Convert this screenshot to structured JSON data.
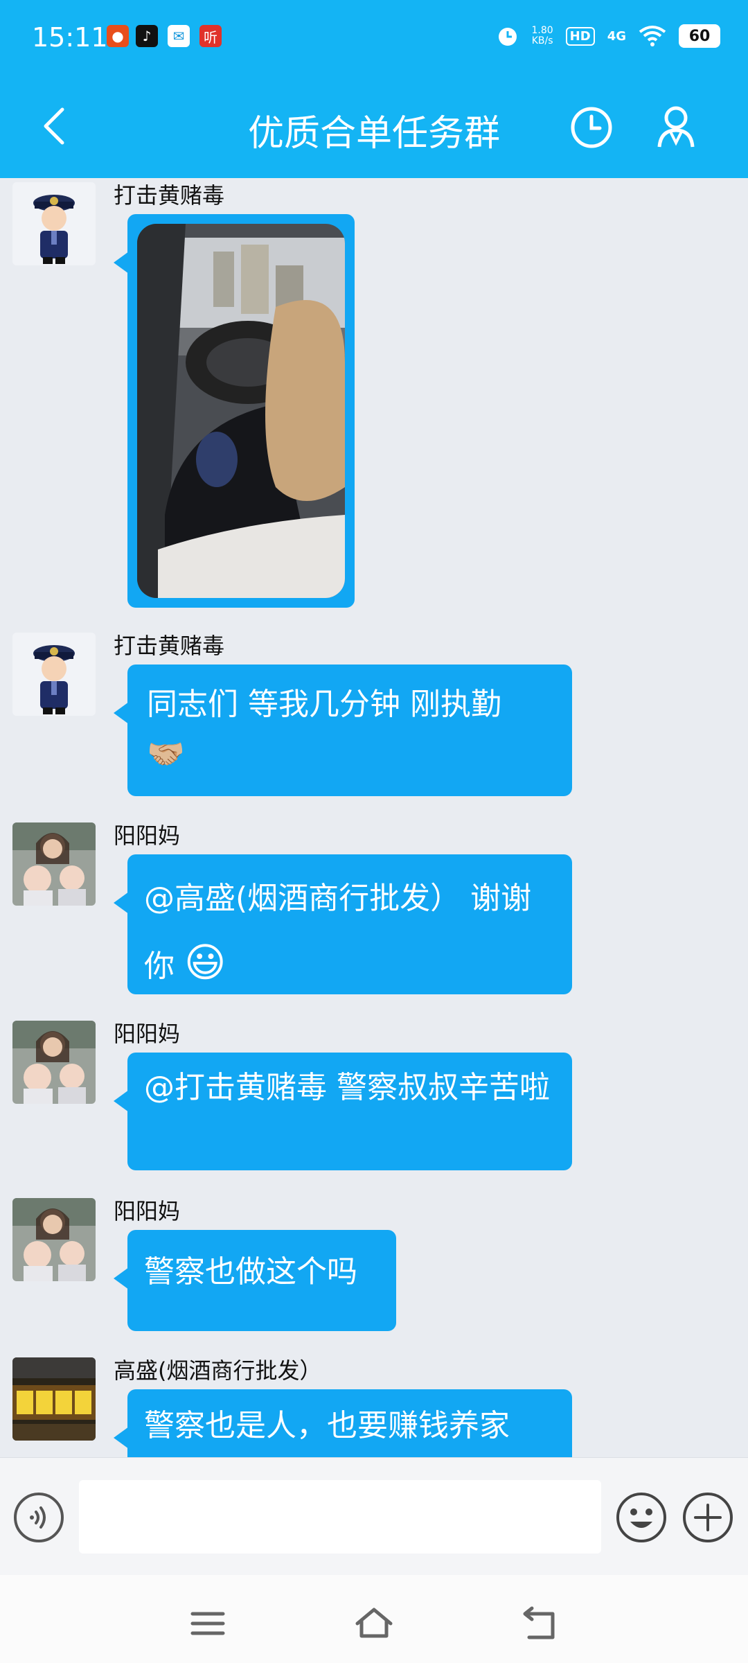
{
  "status": {
    "time": "15:11",
    "apps": [
      "xigua-icon",
      "tiktok-icon",
      "mail-icon",
      "ting-icon"
    ],
    "app_ting_label": "听",
    "speed_value": "1.80",
    "speed_unit": "KB/s",
    "hd": "HD",
    "network": "4G",
    "battery": "60"
  },
  "header": {
    "title": "优质合单任务群"
  },
  "messages": [
    {
      "sender": "打击黄赌毒",
      "type": "image"
    },
    {
      "sender": "打击黄赌毒",
      "text": "同志们 等我几分钟 刚执勤",
      "emoji": "🤝🏼"
    },
    {
      "sender": "阳阳妈",
      "text": "@高盛(烟酒商行批发） 谢谢你",
      "emoji": "😃"
    },
    {
      "sender": "阳阳妈",
      "text": "@打击黄赌毒 警察叔叔辛苦啦"
    },
    {
      "sender": "阳阳妈",
      "text": "警察也做这个吗"
    },
    {
      "sender": "高盛(烟酒商行批发）",
      "text": "警察也是人，也要赚钱养家"
    }
  ],
  "colors": {
    "header_bg": "#14b4f4",
    "bubble_bg": "#12a7f3",
    "chat_bg": "#e9ecf1"
  }
}
